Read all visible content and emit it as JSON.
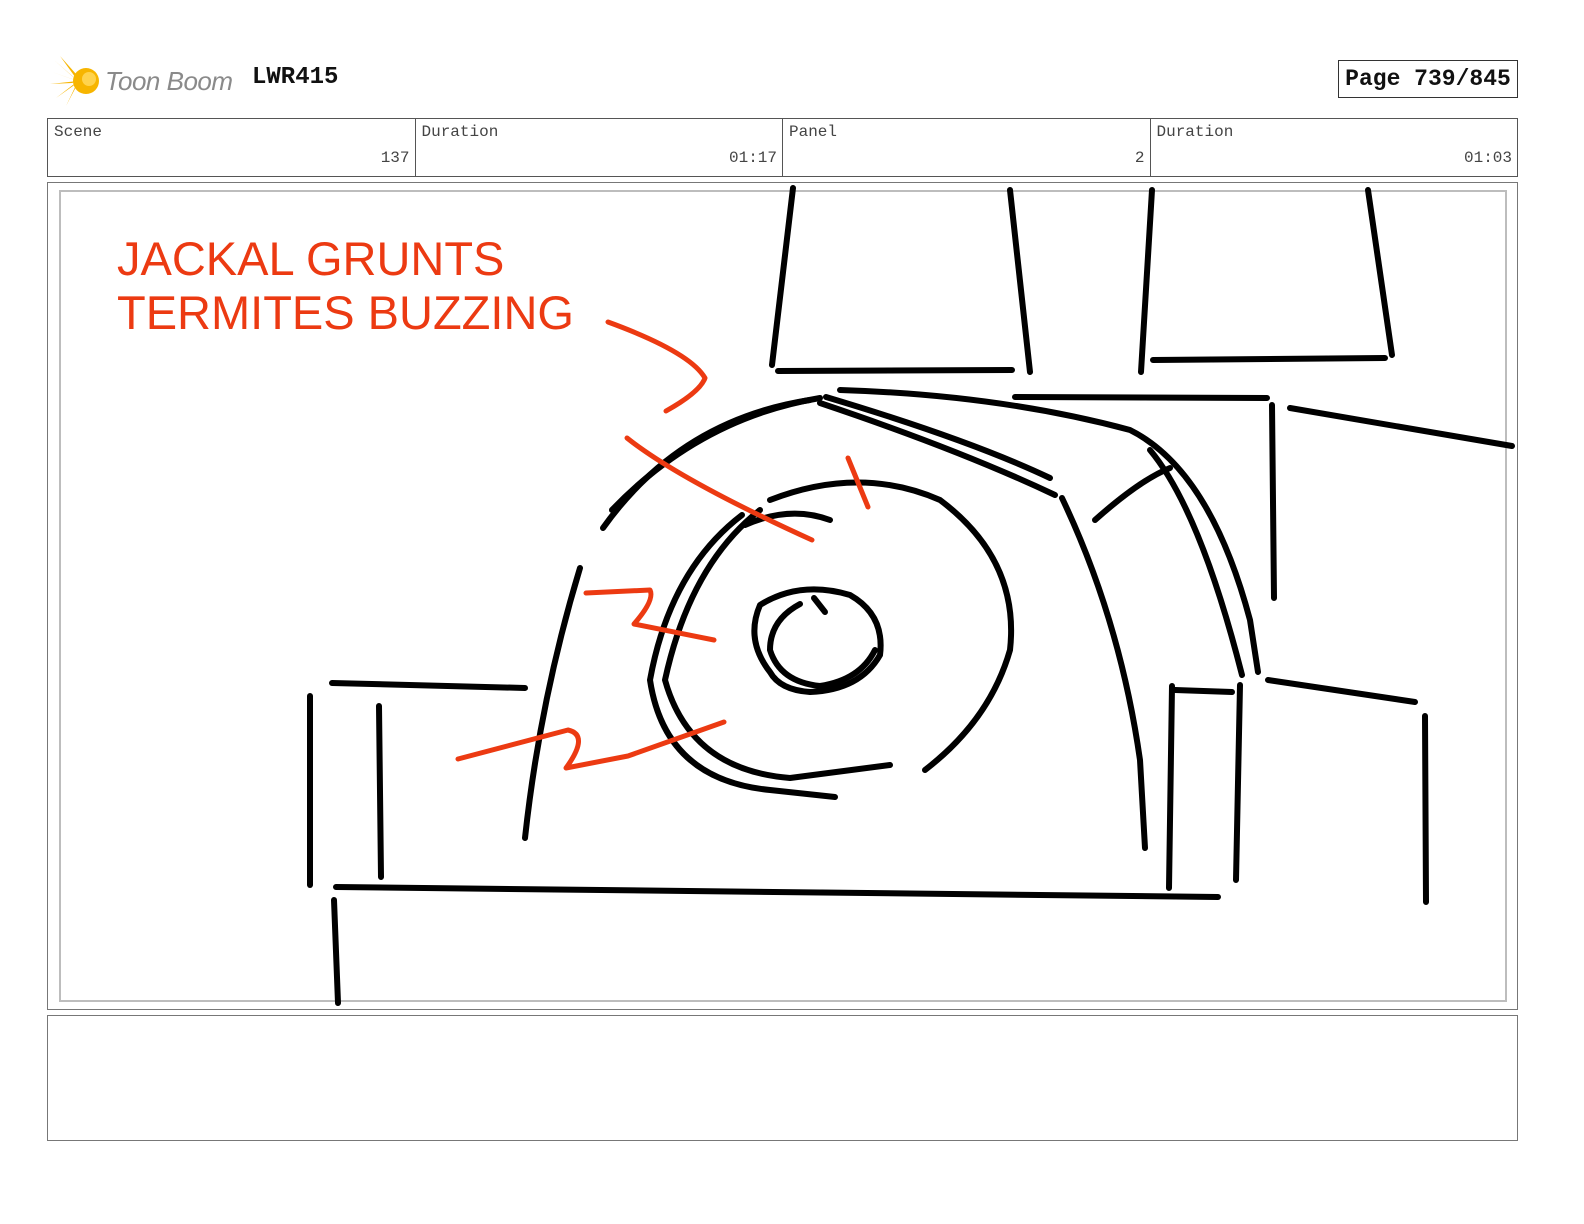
{
  "header": {
    "logo_text": "Toon Boom",
    "project_code": "LWR415",
    "page_label": "Page 739/845"
  },
  "info": {
    "scene_label": "Scene",
    "scene_value": "137",
    "scene_duration_label": "Duration",
    "scene_duration_value": "01:17",
    "panel_label": "Panel",
    "panel_value": "2",
    "panel_duration_label": "Duration",
    "panel_duration_value": "01:03"
  },
  "panel": {
    "sfx_note": "JACKAL GRUNTS\nTERMITES BUZZING",
    "annotation_color": "#ec3a12",
    "sketch_color": "#000000"
  },
  "notes": {
    "text": ""
  },
  "colors": {
    "logo_star": "#f7b500",
    "logo_text": "#8a8a8a",
    "border": "#555555"
  }
}
